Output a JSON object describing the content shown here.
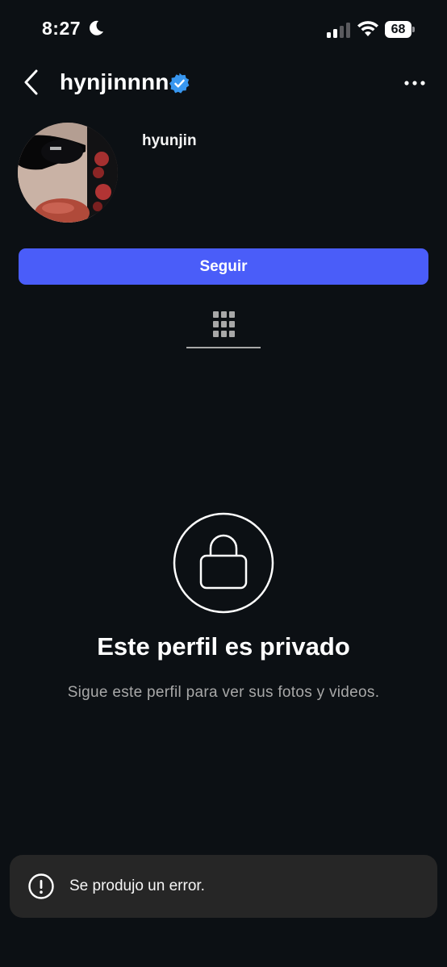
{
  "status_bar": {
    "time": "8:27",
    "battery": "68",
    "icons": [
      "moon-icon",
      "signal-icon",
      "wifi-icon",
      "battery-icon"
    ]
  },
  "header": {
    "username": "hynjinnnn",
    "verified": true,
    "icons": [
      "back-icon",
      "verified-icon",
      "more-icon"
    ]
  },
  "profile": {
    "display_name": "hyunjin",
    "follow_label": "Seguir",
    "avatar_icon": "avatar-photo"
  },
  "tabs": {
    "active": "grid",
    "icon": "grid-icon"
  },
  "private": {
    "icon": "lock-icon",
    "title": "Este perfil es privado",
    "subtitle": "Sigue este perfil para ver sus fotos y videos."
  },
  "toast": {
    "icon": "alert-icon",
    "message": "Se produjo un error."
  },
  "colors": {
    "background": "#0c1014",
    "accent": "#4a5df9",
    "verified": "#3897f0",
    "toast_bg": "#262626",
    "secondary_text": "#a8a8a8"
  }
}
